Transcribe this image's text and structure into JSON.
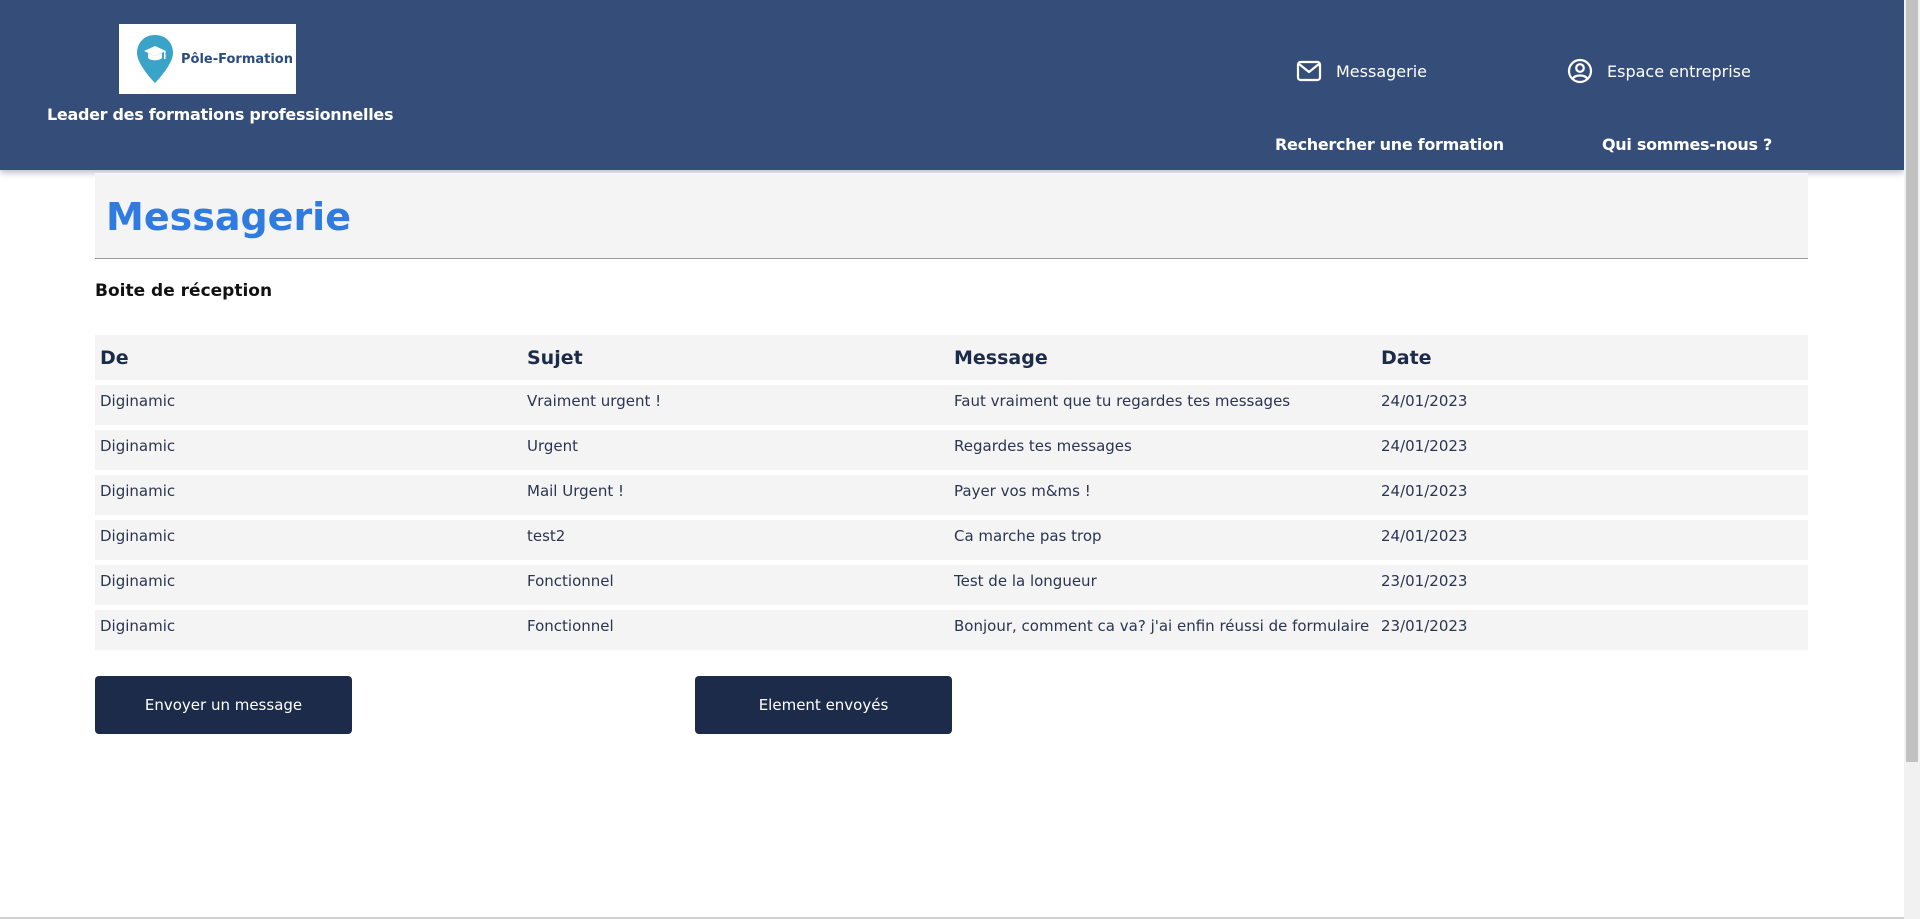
{
  "header": {
    "logo_text": "Pôle-Formation",
    "tagline": "Leader des formations professionnelles",
    "messagerie_link": "Messagerie",
    "espace_link": "Espace entreprise",
    "nav": [
      "Rechercher une formation",
      "Qui sommes-nous ?"
    ]
  },
  "main": {
    "title": "Messagerie",
    "inbox_heading": "Boite de réception",
    "columns": [
      "De",
      "Sujet",
      "Message",
      "Date"
    ],
    "rows": [
      [
        "Diginamic",
        "Vraiment urgent !",
        "Faut vraiment que tu regardes tes messages",
        "24/01/2023"
      ],
      [
        "Diginamic",
        "Urgent",
        "Regardes tes messages",
        "24/01/2023"
      ],
      [
        "Diginamic",
        "Mail Urgent !",
        "Payer vos m&ms !",
        "24/01/2023"
      ],
      [
        "Diginamic",
        "test2",
        "Ca marche pas trop",
        "24/01/2023"
      ],
      [
        "Diginamic",
        "Fonctionnel",
        "Test de la longueur",
        "23/01/2023"
      ],
      [
        "Diginamic",
        "Fonctionnel",
        "Bonjour, comment ca va? j'ai enfin réussi de formulaire",
        "23/01/2023"
      ]
    ],
    "buttons": {
      "send": "Envoyer un message",
      "sent": "Element envoyés"
    }
  },
  "colors": {
    "header_bg": "#354e79",
    "button_bg": "#1c2b4a",
    "title_blue": "#2f7be0",
    "logo_teal": "#3aa3c8"
  },
  "icons": [
    "graduation-pin-icon",
    "envelope-icon",
    "user-circle-icon"
  ]
}
